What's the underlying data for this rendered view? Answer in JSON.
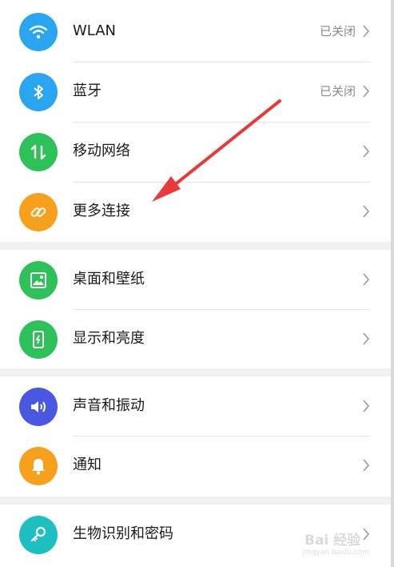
{
  "groups": [
    {
      "rows": [
        {
          "label": "WLAN",
          "status": "已关闭",
          "icon": "wifi-icon",
          "color": "#2aa5ef"
        },
        {
          "label": "蓝牙",
          "status": "已关闭",
          "icon": "bluetooth-icon",
          "color": "#2aa5ef"
        },
        {
          "label": "移动网络",
          "status": "",
          "icon": "mobile-data-icon",
          "color": "#2ec15a"
        },
        {
          "label": "更多连接",
          "status": "",
          "icon": "link-icon",
          "color": "#f6a01b"
        }
      ]
    },
    {
      "rows": [
        {
          "label": "桌面和壁纸",
          "icon": "wallpaper-icon",
          "color": "#2ec15a"
        },
        {
          "label": "显示和亮度",
          "icon": "phone-brightness-icon",
          "color": "#2ec15a"
        }
      ]
    },
    {
      "rows": [
        {
          "label": "声音和振动",
          "icon": "speaker-icon",
          "color": "#4a57e0"
        },
        {
          "label": "通知",
          "icon": "bell-icon",
          "color": "#f6a01b"
        }
      ]
    },
    {
      "rows": [
        {
          "label": "生物识别和密码",
          "icon": "key-icon",
          "color": "#1dbfc1"
        }
      ]
    }
  ],
  "annotation": {
    "color": "#e8393b",
    "name": "red-arrow"
  },
  "watermark": {
    "text": "Bai 经验",
    "sub": "jingyan.baidu.com"
  }
}
